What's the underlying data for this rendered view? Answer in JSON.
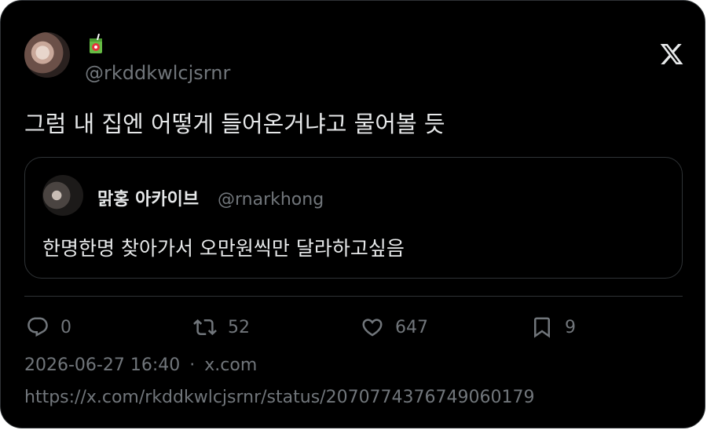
{
  "author": {
    "handle": "@rkddkwlcjsrnr",
    "badge_icon": "juice-box-emoji"
  },
  "tweet": {
    "text": "그럼 내 집엔 어떻게 들어온거냐고 물어볼 듯"
  },
  "quoted": {
    "name": "맑홍 아카이브",
    "handle": "@rnarkhong",
    "text": "한명한명 찾아가서 오만원씩만 달라하고싶음"
  },
  "metrics": {
    "replies": "0",
    "retweets": "52",
    "likes": "647",
    "bookmarks": "9"
  },
  "meta": {
    "timestamp": "2026-06-27 16:40",
    "separator": "·",
    "source": "x.com",
    "url": "https://x.com/rkddkwlcjsrnr/status/2070774376749060179"
  },
  "colors": {
    "background": "#000000",
    "text": "#e7e9ea",
    "muted": "#71767b",
    "border": "#2f3336"
  }
}
